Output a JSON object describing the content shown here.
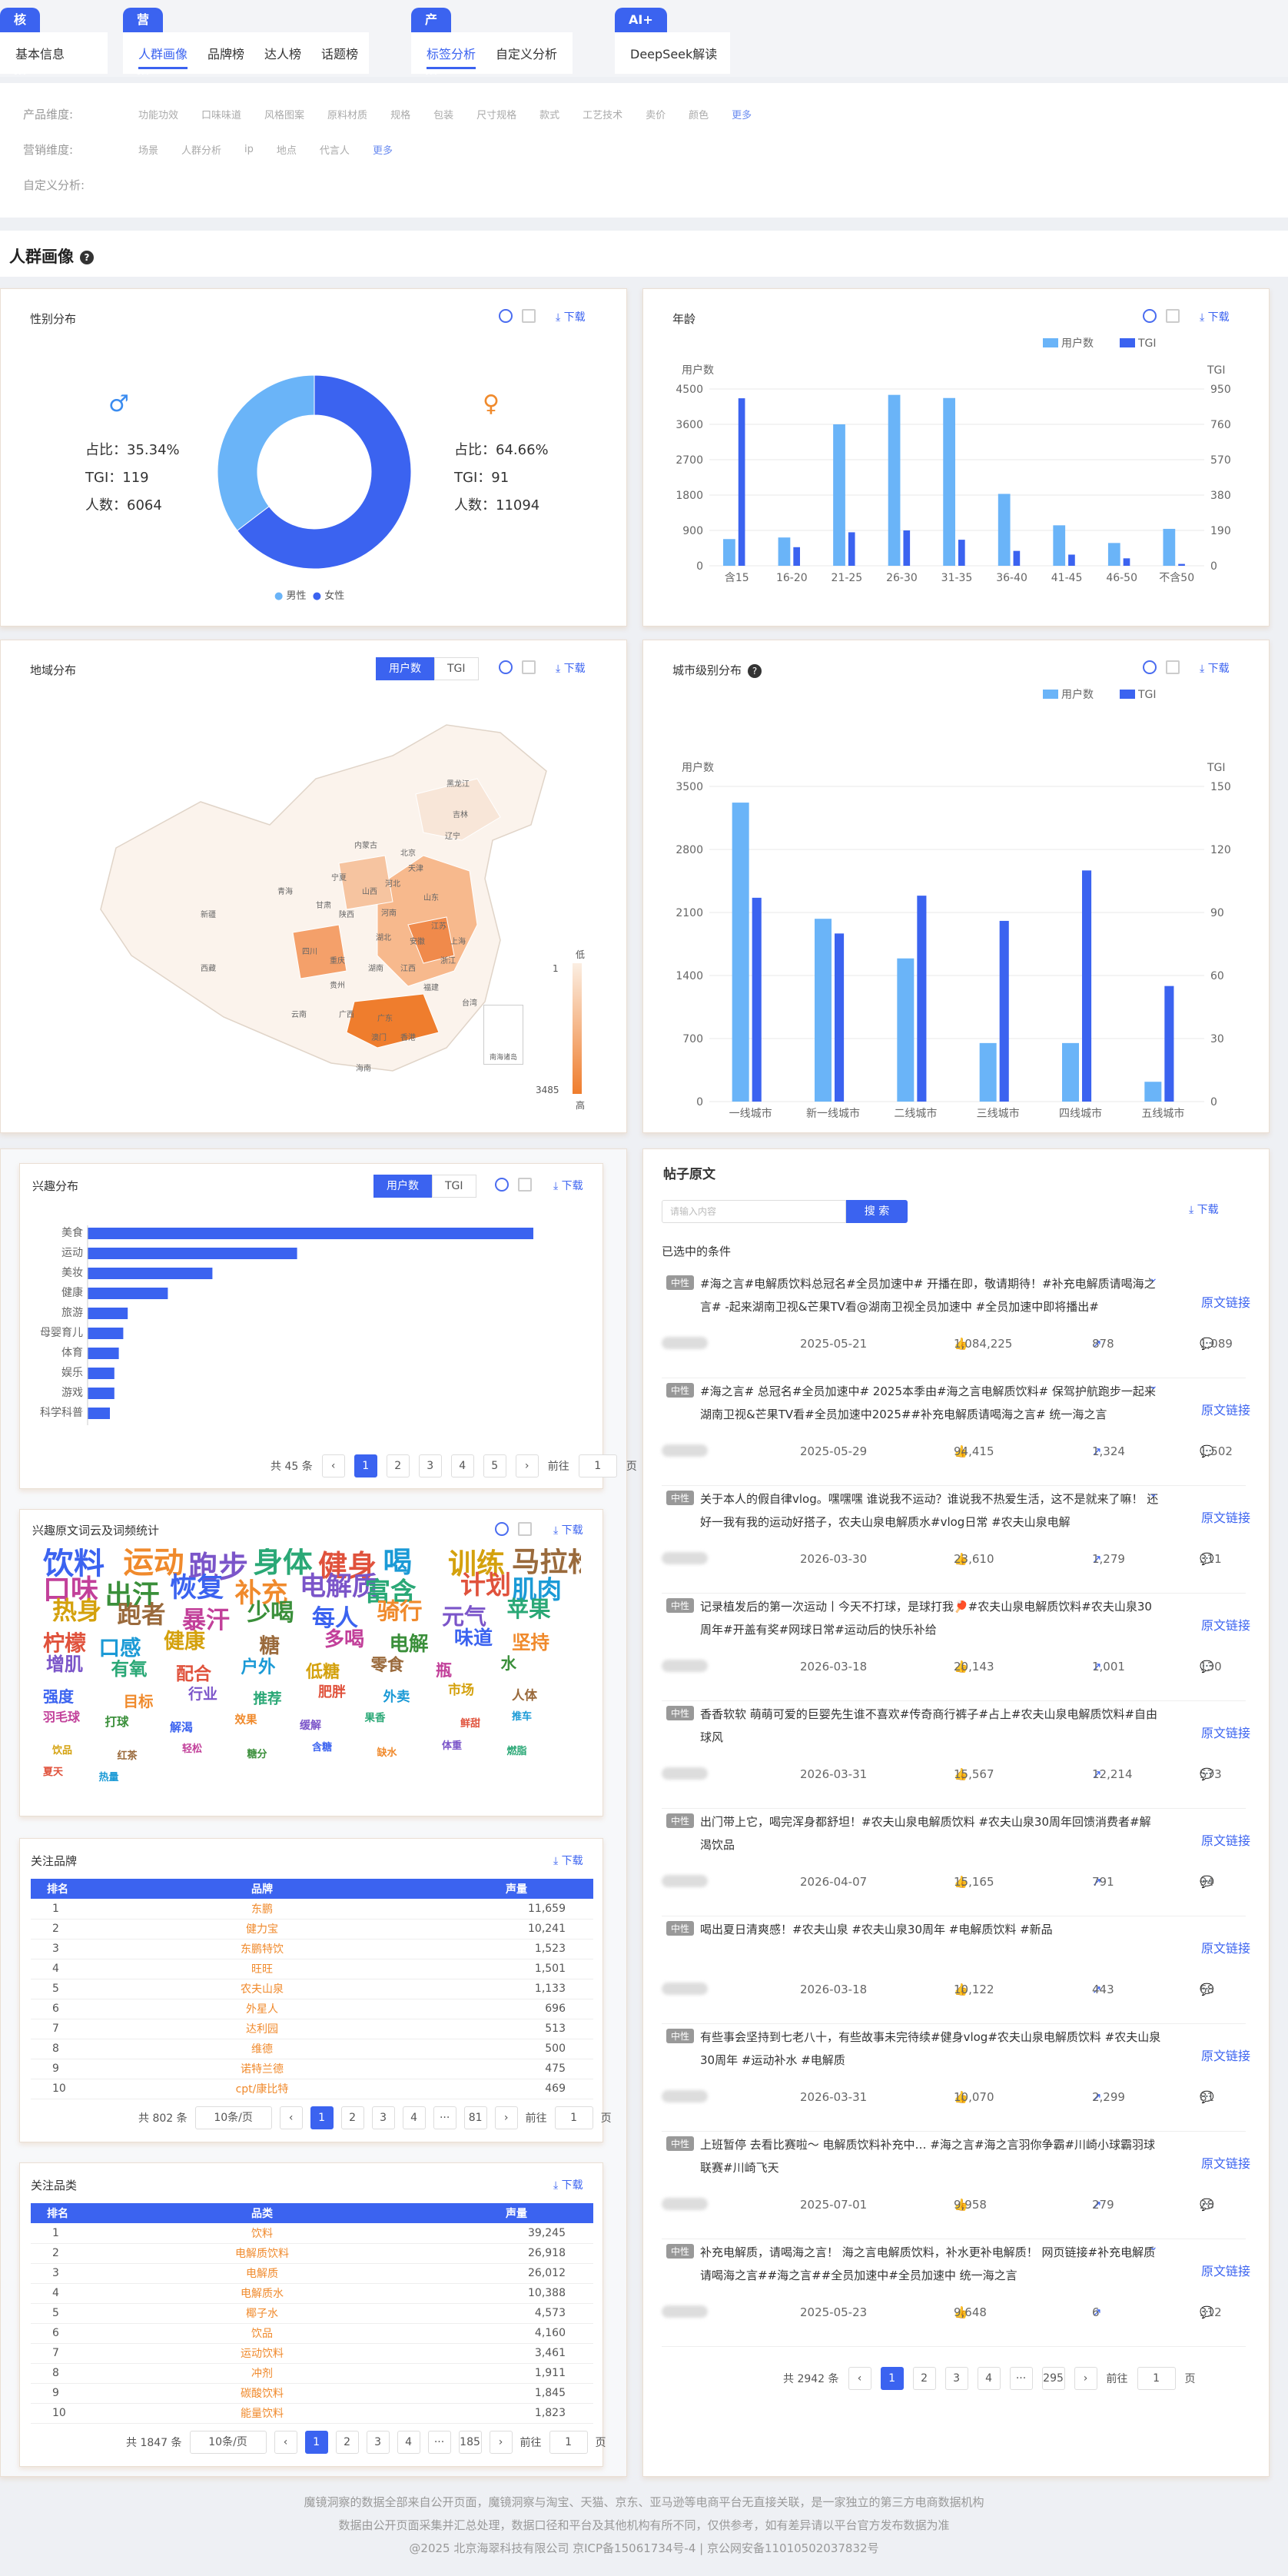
{
  "nav": {
    "groups": [
      {
        "tag": "核心指标",
        "items": [
          "基本信息"
        ],
        "active": -1
      },
      {
        "tag": "营销指标",
        "items": [
          "人群画像",
          "品牌榜",
          "达人榜",
          "话题榜"
        ],
        "active": 0
      },
      {
        "tag": "产品指标",
        "items": [
          "标签分析",
          "自定义分析"
        ],
        "active": 0
      },
      {
        "tag": "AI+",
        "items": [
          "DeepSeek解读"
        ],
        "active": -1
      }
    ]
  },
  "filters": {
    "product_label": "产品维度:",
    "product_items": [
      "功能功效",
      "口味味道",
      "风格图案",
      "原料材质",
      "规格",
      "包装",
      "尺寸规格",
      "款式",
      "工艺技术",
      "卖价",
      "颜色"
    ],
    "more": "更多",
    "marketing_label": "营销维度:",
    "marketing_items": [
      "场景",
      "人群分析",
      "ip",
      "地点",
      "代言人"
    ],
    "custom_label": "自定义分析:"
  },
  "section_title": "人群画像",
  "download": "下载",
  "seg_users": "用户数",
  "seg_tgi": "TGI",
  "gender": {
    "title": "性别分布",
    "male": {
      "ratio": "占比：35.34%",
      "tgi": "TGI：119",
      "count": "人数：6064",
      "pct": 35.34
    },
    "female": {
      "ratio": "占比：64.66%",
      "tgi": "TGI：91",
      "count": "人数：11094",
      "pct": 64.66
    },
    "legend_male": "男性",
    "legend_female": "女性",
    "colors": {
      "male": "#6ab4f8",
      "female": "#3b63f0"
    }
  },
  "chart_data": [
    {
      "type": "bar",
      "title": "年龄",
      "ylabel": "用户数",
      "y2label": "TGI",
      "categories": [
        "含15",
        "16-20",
        "21-25",
        "26-30",
        "31-35",
        "36-40",
        "41-45",
        "46-50",
        "不含50"
      ],
      "series": [
        {
          "name": "用户数",
          "values": [
            680,
            720,
            3600,
            4350,
            4270,
            1830,
            1030,
            580,
            940
          ]
        },
        {
          "name": "TGI",
          "values": [
            900,
            100,
            180,
            190,
            140,
            80,
            60,
            40,
            10
          ]
        }
      ],
      "ylim": [
        0,
        4500
      ],
      "y2lim": [
        0,
        950
      ],
      "yticks": [
        0,
        900,
        1800,
        2700,
        3600,
        4500
      ],
      "y2ticks": [
        0,
        190,
        380,
        570,
        760,
        950
      ]
    },
    {
      "type": "bar",
      "title": "城市级别分布",
      "ylabel": "用户数",
      "y2label": "TGI",
      "categories": [
        "一线城市",
        "新一线城市",
        "二线城市",
        "三线城市",
        "四线城市",
        "五线城市"
      ],
      "series": [
        {
          "name": "用户数",
          "values": [
            3320,
            2030,
            1590,
            650,
            650,
            220
          ]
        },
        {
          "name": "TGI",
          "values": [
            97,
            80,
            98,
            86,
            110,
            55
          ]
        }
      ],
      "ylim": [
        0,
        3500
      ],
      "y2lim": [
        0,
        150
      ],
      "yticks": [
        0,
        700,
        1400,
        2100,
        2800,
        3500
      ],
      "y2ticks": [
        0,
        30,
        60,
        90,
        120,
        150
      ]
    },
    {
      "type": "bar",
      "title": "兴趣分布",
      "categories": [
        "美食",
        "运动",
        "美妆",
        "健康",
        "旅游",
        "母婴育儿",
        "体育",
        "娱乐",
        "游戏",
        "科学科普"
      ],
      "values": [
        100,
        47,
        28,
        18,
        9,
        8,
        7,
        6,
        6,
        5
      ]
    }
  ],
  "region": {
    "title": "地域分布",
    "legend_low": "低",
    "legend_high": "高",
    "legend_min": "1",
    "legend_max": "3485",
    "inset_label": "南海诸岛",
    "provinces": [
      "黑龙江",
      "吉林",
      "辽宁",
      "内蒙古",
      "北京",
      "天津",
      "河北",
      "山西",
      "山东",
      "宁夏",
      "青海",
      "甘肃",
      "陕西",
      "河南",
      "江苏",
      "西藏",
      "四川",
      "重庆",
      "湖北",
      "安徽",
      "上海",
      "浙江",
      "湖南",
      "江西",
      "福建",
      "贵州",
      "云南",
      "广西",
      "广东",
      "台湾",
      "香港",
      "澳门",
      "海南",
      "新疆"
    ]
  },
  "interest": {
    "total": "共 45 条",
    "pages": [
      "1",
      "2",
      "3",
      "4",
      "5"
    ],
    "goto": "前往",
    "page_input": "1",
    "page_unit": "页"
  },
  "wordcloud": {
    "title": "兴趣原文词云及词频统计",
    "words": [
      "饮料",
      "运动",
      "跑步",
      "身体",
      "健身",
      "喝",
      "训练",
      "马拉松",
      "口味",
      "出汗",
      "恢复",
      "补充",
      "电解质",
      "富含",
      "计划",
      "肌肉",
      "热身",
      "跑者",
      "暴汗",
      "少喝",
      "每人",
      "骑行",
      "元气",
      "苹果",
      "柠檬",
      "口感",
      "健康",
      "糖",
      "多喝",
      "电解",
      "味道",
      "坚持",
      "增肌",
      "有氧",
      "配合",
      "户外",
      "低糖",
      "零食",
      "瓶",
      "水",
      "强度",
      "目标",
      "行业",
      "推荐",
      "肥胖",
      "外卖",
      "市场",
      "人体",
      "羽毛球",
      "打球",
      "解渴",
      "效果",
      "缓解",
      "果香",
      "鲜甜",
      "推车",
      "饮品",
      "红茶",
      "轻松",
      "糖分",
      "含糖",
      "缺水",
      "体重",
      "燃脂",
      "夏天",
      "热量"
    ]
  },
  "brands": {
    "title": "关注品牌",
    "headers": [
      "排名",
      "品牌",
      "声量"
    ],
    "rows": [
      [
        "1",
        "东鹏",
        "11,659"
      ],
      [
        "2",
        "健力宝",
        "10,241"
      ],
      [
        "3",
        "东鹏特饮",
        "1,523"
      ],
      [
        "4",
        "旺旺",
        "1,501"
      ],
      [
        "5",
        "农夫山泉",
        "1,133"
      ],
      [
        "6",
        "外星人",
        "696"
      ],
      [
        "7",
        "达利园",
        "513"
      ],
      [
        "8",
        "维德",
        "500"
      ],
      [
        "9",
        "诺特兰德",
        "475"
      ],
      [
        "10",
        "cpt/康比特",
        "469"
      ]
    ],
    "total": "共 802 条",
    "per_page": "10条/页",
    "pages": [
      "1",
      "2",
      "3",
      "4",
      "···",
      "81"
    ],
    "goto": "前往",
    "page_input": "1",
    "page_unit": "页"
  },
  "categories": {
    "title": "关注品类",
    "headers": [
      "排名",
      "品类",
      "声量"
    ],
    "rows": [
      [
        "1",
        "饮料",
        "39,245"
      ],
      [
        "2",
        "电解质饮料",
        "26,918"
      ],
      [
        "3",
        "电解质",
        "26,012"
      ],
      [
        "4",
        "电解质水",
        "10,388"
      ],
      [
        "5",
        "椰子水",
        "4,573"
      ],
      [
        "6",
        "饮品",
        "4,160"
      ],
      [
        "7",
        "运动饮料",
        "3,461"
      ],
      [
        "8",
        "冲剂",
        "1,911"
      ],
      [
        "9",
        "碳酸饮料",
        "1,845"
      ],
      [
        "10",
        "能量饮料",
        "1,823"
      ]
    ],
    "total": "共 1847 条",
    "per_page": "10条/页",
    "pages": [
      "1",
      "2",
      "3",
      "4",
      "···",
      "185"
    ],
    "goto": "前往",
    "page_input": "1",
    "page_unit": "页"
  },
  "posts": {
    "title": "帖子原文",
    "search_placeholder": "请输入内容",
    "search_button": "搜 索",
    "selected_label": "已选中的条件",
    "link_label": "原文链接",
    "items": [
      {
        "tag": "中性",
        "text": "#海之言#电解质饮料总冠名#全员加速中# 开播在即，敬请期待！#补充电解质请喝海之言# -起来湖南卫视&芒果TV看@湖南卫视全员加速中 #全员加速中即将播出#",
        "date": "2025-05-21",
        "likes": "1,084,225",
        "shares": "878",
        "comments": "1,089",
        "expand": true
      },
      {
        "tag": "中性",
        "text": "#海之言# 总冠名#全员加速中# 2025本季由#海之言电解质饮料# 保驾护航跑步一起来湖南卫视&芒果TV看#全员加速中2025##补充电解质请喝海之言# 统一海之言",
        "date": "2025-05-29",
        "likes": "94,415",
        "shares": "1,324",
        "comments": "1,502",
        "expand": true
      },
      {
        "tag": "中性",
        "text": "关于本人的假自律vlog。嘿嘿嘿 谁说我不运动？谁说我不热爱生活，这不是就来了嘛！ 还好一我有我的运动好搭子，农夫山泉电解质水#vlog日常 #农夫山泉电解",
        "date": "2026-03-30",
        "likes": "23,610",
        "shares": "1,279",
        "comments": "311",
        "expand": true
      },
      {
        "tag": "中性",
        "text": "记录植发后的第一次运动丨今天不打球，是球打我🏓#农夫山泉电解质饮料#农夫山泉30周年#开盖有奖#网球日常#运动后的快乐补给",
        "date": "2026-03-18",
        "likes": "20,143",
        "shares": "1,001",
        "comments": "130",
        "expand": false
      },
      {
        "tag": "中性",
        "text": "香香软软 萌萌可爱的巨婴先生谁不喜欢#传奇商行裤子#占上#农夫山泉电解质饮料#自由球风",
        "date": "2026-03-31",
        "likes": "15,567",
        "shares": "12,214",
        "comments": "573",
        "expand": false
      },
      {
        "tag": "中性",
        "text": "出门带上它，喝完浑身都舒坦！#农夫山泉电解质饮料 #农夫山泉30周年回馈消费者#解渴饮品",
        "date": "2026-04-07",
        "likes": "15,165",
        "shares": "791",
        "comments": "94",
        "expand": false
      },
      {
        "tag": "中性",
        "text": "喝出夏日清爽感！#农夫山泉 #农夫山泉30周年 #电解质饮料 #新品",
        "date": "2026-03-18",
        "likes": "10,122",
        "shares": "443",
        "comments": "68",
        "expand": false
      },
      {
        "tag": "中性",
        "text": "有些事会坚持到七老八十，有些故事未完待续#健身vlog#农夫山泉电解质饮料 #农夫山泉30周年 #运动补水 #电解质",
        "date": "2026-03-31",
        "likes": "10,070",
        "shares": "2,299",
        "comments": "81",
        "expand": false
      },
      {
        "tag": "中性",
        "text": "上班暂停 去看比赛啦～ 电解质饮料补充中… #海之言#海之言羽你争霸#川崎小球霸羽球联赛#川崎飞天",
        "date": "2025-07-01",
        "likes": "9,958",
        "shares": "279",
        "comments": "28",
        "expand": false
      },
      {
        "tag": "中性",
        "text": "补充电解质，请喝海之言！ 海之言电解质饮料，补水更补电解质！ 网页链接#补充电解质请喝海之言##海之言##全员加速中#全员加速中 统一海之言",
        "date": "2025-05-23",
        "likes": "9,648",
        "shares": "6",
        "comments": "312",
        "expand": true
      }
    ],
    "total": "共 2942 条",
    "pages": [
      "1",
      "2",
      "3",
      "4",
      "···",
      "295"
    ],
    "goto": "前往",
    "page_input": "1",
    "page_unit": "页"
  },
  "footer": {
    "line1": "魔镜洞察的数据全部来自公开页面，魔镜洞察与淘宝、天猫、京东、亚马逊等电商平台无直接关联，是一家独立的第三方电商数据机构",
    "line2": "数据由公开页面采集并汇总处理，数据口径和平台及其他机构有所不同，仅供参考，如有差异请以平台官方发布数据为准",
    "line3": "@2025 北京海翠科技有限公司 京ICP备15061734号-4 | 京公网安备11010502037832号"
  }
}
